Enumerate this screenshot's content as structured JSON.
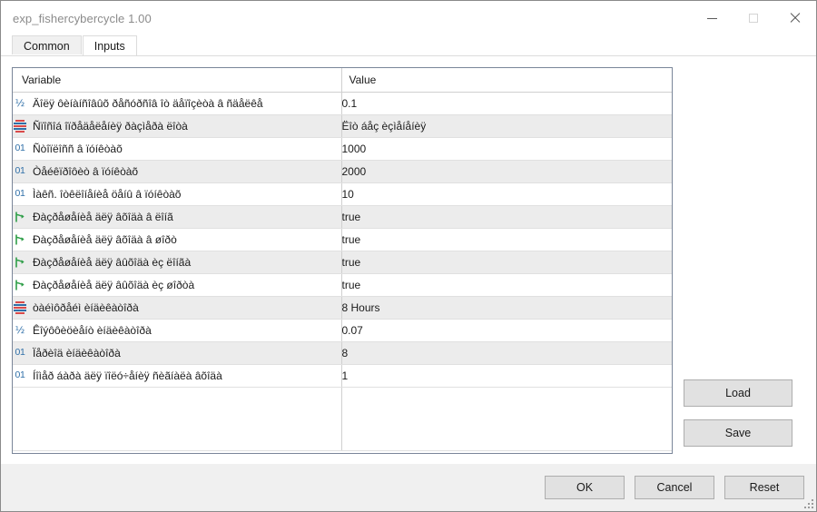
{
  "window": {
    "title": "exp_fishercybercycle 1.00",
    "controls": {
      "minimize": "minimize-button",
      "maximize": "maximize-button",
      "close": "close-button"
    }
  },
  "tabs": [
    {
      "label": "Common",
      "active": false
    },
    {
      "label": "Inputs",
      "active": true
    }
  ],
  "grid": {
    "headers": {
      "variable": "Variable",
      "value": "Value"
    },
    "rows": [
      {
        "icon": "double",
        "variable": "Äîëÿ ôèíàíñîâûõ ðåñóðñîâ îò äåïîçèòà â ñäåëêå",
        "value": "0.1"
      },
      {
        "icon": "enum",
        "variable": "Ñïîñîá îïðåäåëåíèÿ ðàçìåðà ëîòà",
        "value": "Ëîò áåç èçìåíåíèÿ"
      },
      {
        "icon": "int",
        "variable": "Ñòîïëîññ â ïóíêòàõ",
        "value": "1000"
      },
      {
        "icon": "int",
        "variable": "Òåéêïðîôèò â ïóíêòàõ",
        "value": "2000"
      },
      {
        "icon": "int",
        "variable": "Ìàêñ. îòêëîíåíèå öåíû â ïóíêòàõ",
        "value": "10"
      },
      {
        "icon": "bool",
        "variable": "Ðàçðåøåíèå äëÿ âõîäà â ëîíã",
        "value": "true"
      },
      {
        "icon": "bool",
        "variable": "Ðàçðåøåíèå äëÿ âõîäà â øîðò",
        "value": "true"
      },
      {
        "icon": "bool",
        "variable": "Ðàçðåøåíèå äëÿ âûõîäà èç ëîíãà",
        "value": "true"
      },
      {
        "icon": "bool",
        "variable": "Ðàçðåøåíèå äëÿ âûõîäà èç øîðòà",
        "value": "true"
      },
      {
        "icon": "enum",
        "variable": "òàéìôðåéì èíäèêàòîðà",
        "value": "8 Hours"
      },
      {
        "icon": "double",
        "variable": "Êîýôôèöèåíò èíäèêàòîðà",
        "value": "0.07"
      },
      {
        "icon": "int",
        "variable": "Ïåðèîä èíäèêàòîðà",
        "value": "8"
      },
      {
        "icon": "int",
        "variable": "Íîìåð áàðà äëÿ ïîëó÷åíèÿ ñèãíàëà âõîäà",
        "value": "1"
      }
    ]
  },
  "side_buttons": [
    {
      "label": "Load"
    },
    {
      "label": "Save"
    }
  ],
  "footer_buttons": [
    {
      "label": "OK"
    },
    {
      "label": "Cancel"
    },
    {
      "label": "Reset"
    }
  ],
  "colors": {
    "accent_blue": "#2f6fa8",
    "enum_red": "#d94a4a",
    "bool_green": "#2e9e48",
    "alt_row": "#ececec",
    "grid_border": "#7a8699"
  }
}
